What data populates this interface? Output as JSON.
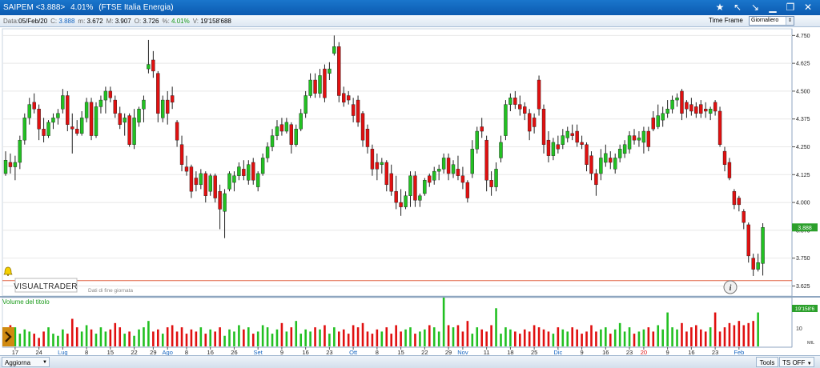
{
  "window": {
    "symbol": "SAIPEM <3.888>",
    "change": "4.01%",
    "index": "(FTSE Italia Energia)"
  },
  "info": {
    "data_label": "Data:",
    "date": "05/Feb/20",
    "close_label": "C:",
    "close": "3.888",
    "min_label": "m:",
    "min": "3.672",
    "max_label": "M:",
    "max": "3.907",
    "open_label": "O:",
    "open": "3.726",
    "pct_label": "%:",
    "pct": "4.01%",
    "vol_label": "V:",
    "volume": "19'158'688",
    "timeframe_label": "Time Frame",
    "timeframe_value": "Giornaliero"
  },
  "branding": {
    "logo": "VISUALTRADER",
    "note": "Dati di fine giornata"
  },
  "volume_panel": {
    "title": "Volume del titolo",
    "last_value": "19'158'6",
    "scale_label": "10",
    "unit_label": "MIL"
  },
  "status": {
    "update_label": "Aggiorna",
    "tools_label": "Tools",
    "ts_label": "TS OFF"
  },
  "colors": {
    "up": "#22c022",
    "down": "#e01010",
    "accent": "#1565c0",
    "alert_line": "#e06040",
    "price_box": "#2ca02c"
  },
  "icons": [
    "star-icon",
    "arrow-up-left-icon",
    "arrow-down-right-icon",
    "minimize-icon",
    "restore-icon",
    "close-icon",
    "bell-icon",
    "info-icon",
    "chevron-right-icon"
  ],
  "chart_data": {
    "type": "candlestick",
    "price_axis": {
      "ticks": [
        3.625,
        3.75,
        3.875,
        4.0,
        4.125,
        4.25,
        4.375,
        4.5,
        4.625,
        4.75
      ],
      "ylim": [
        3.58,
        4.78
      ]
    },
    "last_price_label": "3.888",
    "alert_level": 3.649,
    "x_labels": [
      {
        "i": 2,
        "t": "17"
      },
      {
        "i": 7,
        "t": "24"
      },
      {
        "i": 12,
        "t": "Lug",
        "month": true
      },
      {
        "i": 17,
        "t": "8"
      },
      {
        "i": 22,
        "t": "15"
      },
      {
        "i": 27,
        "t": "22"
      },
      {
        "i": 31,
        "t": "29"
      },
      {
        "i": 34,
        "t": "Ago",
        "month": true
      },
      {
        "i": 38,
        "t": "8"
      },
      {
        "i": 43,
        "t": "16"
      },
      {
        "i": 48,
        "t": "26"
      },
      {
        "i": 53,
        "t": "Set",
        "month": true
      },
      {
        "i": 58,
        "t": "9"
      },
      {
        "i": 63,
        "t": "16"
      },
      {
        "i": 68,
        "t": "23"
      },
      {
        "i": 73,
        "t": "Ott",
        "month": true
      },
      {
        "i": 78,
        "t": "8"
      },
      {
        "i": 83,
        "t": "15"
      },
      {
        "i": 88,
        "t": "22"
      },
      {
        "i": 93,
        "t": "29"
      },
      {
        "i": 96,
        "t": "Nov",
        "month": true
      },
      {
        "i": 101,
        "t": "11"
      },
      {
        "i": 106,
        "t": "18"
      },
      {
        "i": 111,
        "t": "25"
      },
      {
        "i": 116,
        "t": "Dic",
        "month": true
      },
      {
        "i": 121,
        "t": "9"
      },
      {
        "i": 126,
        "t": "16"
      },
      {
        "i": 131,
        "t": "23"
      },
      {
        "i": 134,
        "t": "20",
        "year": true
      },
      {
        "i": 139,
        "t": "9"
      },
      {
        "i": 144,
        "t": "16"
      },
      {
        "i": 149,
        "t": "23"
      },
      {
        "i": 154,
        "t": "Feb",
        "month": true
      }
    ],
    "candles": [
      {
        "o": 4.13,
        "h": 4.23,
        "l": 4.12,
        "c": 4.19
      },
      {
        "o": 4.18,
        "h": 4.22,
        "l": 4.13,
        "c": 4.16
      },
      {
        "o": 4.16,
        "h": 4.21,
        "l": 4.1,
        "c": 4.18
      },
      {
        "o": 4.18,
        "h": 4.3,
        "l": 4.15,
        "c": 4.28
      },
      {
        "o": 4.28,
        "h": 4.4,
        "l": 4.26,
        "c": 4.38
      },
      {
        "o": 4.38,
        "h": 4.47,
        "l": 4.35,
        "c": 4.44
      },
      {
        "o": 4.45,
        "h": 4.49,
        "l": 4.4,
        "c": 4.42
      },
      {
        "o": 4.42,
        "h": 4.44,
        "l": 4.28,
        "c": 4.33
      },
      {
        "o": 4.33,
        "h": 4.38,
        "l": 4.27,
        "c": 4.3
      },
      {
        "o": 4.3,
        "h": 4.37,
        "l": 4.29,
        "c": 4.36
      },
      {
        "o": 4.36,
        "h": 4.4,
        "l": 4.33,
        "c": 4.38
      },
      {
        "o": 4.38,
        "h": 4.42,
        "l": 4.35,
        "c": 4.4
      },
      {
        "o": 4.42,
        "h": 4.51,
        "l": 4.4,
        "c": 4.48
      },
      {
        "o": 4.48,
        "h": 4.5,
        "l": 4.32,
        "c": 4.35
      },
      {
        "o": 4.34,
        "h": 4.4,
        "l": 4.22,
        "c": 4.33
      },
      {
        "o": 4.33,
        "h": 4.37,
        "l": 4.3,
        "c": 4.31
      },
      {
        "o": 4.31,
        "h": 4.41,
        "l": 4.3,
        "c": 4.38
      },
      {
        "o": 4.38,
        "h": 4.47,
        "l": 4.36,
        "c": 4.45
      },
      {
        "o": 4.45,
        "h": 4.47,
        "l": 4.28,
        "c": 4.3
      },
      {
        "o": 4.3,
        "h": 4.45,
        "l": 4.29,
        "c": 4.43
      },
      {
        "o": 4.43,
        "h": 4.48,
        "l": 4.4,
        "c": 4.46
      },
      {
        "o": 4.46,
        "h": 4.52,
        "l": 4.4,
        "c": 4.5
      },
      {
        "o": 4.5,
        "h": 4.52,
        "l": 4.45,
        "c": 4.47
      },
      {
        "o": 4.46,
        "h": 4.48,
        "l": 4.38,
        "c": 4.4
      },
      {
        "o": 4.4,
        "h": 4.43,
        "l": 4.33,
        "c": 4.35
      },
      {
        "o": 4.36,
        "h": 4.4,
        "l": 4.3,
        "c": 4.38
      },
      {
        "o": 4.39,
        "h": 4.4,
        "l": 4.25,
        "c": 4.26
      },
      {
        "o": 4.26,
        "h": 4.42,
        "l": 4.24,
        "c": 4.38
      },
      {
        "o": 4.36,
        "h": 4.43,
        "l": 4.34,
        "c": 4.42
      },
      {
        "o": 4.42,
        "h": 4.48,
        "l": 4.36,
        "c": 4.46
      },
      {
        "o": 4.6,
        "h": 4.73,
        "l": 4.58,
        "c": 4.62
      },
      {
        "o": 4.64,
        "h": 4.68,
        "l": 4.56,
        "c": 4.59
      },
      {
        "o": 4.58,
        "h": 4.59,
        "l": 4.36,
        "c": 4.4
      },
      {
        "o": 4.38,
        "h": 4.48,
        "l": 4.36,
        "c": 4.46
      },
      {
        "o": 4.46,
        "h": 4.5,
        "l": 4.35,
        "c": 4.4
      },
      {
        "o": 4.48,
        "h": 4.52,
        "l": 4.42,
        "c": 4.45
      },
      {
        "o": 4.36,
        "h": 4.37,
        "l": 4.25,
        "c": 4.28
      },
      {
        "o": 4.26,
        "h": 4.3,
        "l": 4.14,
        "c": 4.17
      },
      {
        "o": 4.16,
        "h": 4.21,
        "l": 4.12,
        "c": 4.14
      },
      {
        "o": 4.16,
        "h": 4.17,
        "l": 4.02,
        "c": 4.05
      },
      {
        "o": 4.11,
        "h": 4.14,
        "l": 4.05,
        "c": 4.08
      },
      {
        "o": 4.08,
        "h": 4.15,
        "l": 4.06,
        "c": 4.13
      },
      {
        "o": 4.13,
        "h": 4.14,
        "l": 4.0,
        "c": 4.03
      },
      {
        "o": 4.05,
        "h": 4.13,
        "l": 4.03,
        "c": 4.12
      },
      {
        "o": 4.12,
        "h": 4.13,
        "l": 4.0,
        "c": 4.02
      },
      {
        "o": 4.05,
        "h": 4.08,
        "l": 3.88,
        "c": 3.97
      },
      {
        "o": 3.96,
        "h": 4.06,
        "l": 3.84,
        "c": 4.04
      },
      {
        "o": 4.06,
        "h": 4.14,
        "l": 4.05,
        "c": 4.13
      },
      {
        "o": 4.09,
        "h": 4.14,
        "l": 4.05,
        "c": 4.12
      },
      {
        "o": 4.12,
        "h": 4.18,
        "l": 4.1,
        "c": 4.16
      },
      {
        "o": 4.15,
        "h": 4.19,
        "l": 4.1,
        "c": 4.12
      },
      {
        "o": 4.1,
        "h": 4.19,
        "l": 4.08,
        "c": 4.17
      },
      {
        "o": 4.18,
        "h": 4.2,
        "l": 4.08,
        "c": 4.1
      },
      {
        "o": 4.07,
        "h": 4.14,
        "l": 4.05,
        "c": 4.13
      },
      {
        "o": 4.13,
        "h": 4.22,
        "l": 4.12,
        "c": 4.2
      },
      {
        "o": 4.2,
        "h": 4.27,
        "l": 4.18,
        "c": 4.25
      },
      {
        "o": 4.25,
        "h": 4.33,
        "l": 4.23,
        "c": 4.3
      },
      {
        "o": 4.3,
        "h": 4.37,
        "l": 4.28,
        "c": 4.34
      },
      {
        "o": 4.35,
        "h": 4.38,
        "l": 4.3,
        "c": 4.32
      },
      {
        "o": 4.32,
        "h": 4.38,
        "l": 4.31,
        "c": 4.36
      },
      {
        "o": 4.35,
        "h": 4.36,
        "l": 4.22,
        "c": 4.26
      },
      {
        "o": 4.26,
        "h": 4.35,
        "l": 4.25,
        "c": 4.33
      },
      {
        "o": 4.33,
        "h": 4.42,
        "l": 4.32,
        "c": 4.4
      },
      {
        "o": 4.4,
        "h": 4.5,
        "l": 4.38,
        "c": 4.48
      },
      {
        "o": 4.48,
        "h": 4.58,
        "l": 4.47,
        "c": 4.55
      },
      {
        "o": 4.55,
        "h": 4.58,
        "l": 4.47,
        "c": 4.49
      },
      {
        "o": 4.49,
        "h": 4.6,
        "l": 4.47,
        "c": 4.57
      },
      {
        "o": 4.6,
        "h": 4.62,
        "l": 4.45,
        "c": 4.47
      },
      {
        "o": 4.58,
        "h": 4.63,
        "l": 4.55,
        "c": 4.6
      },
      {
        "o": 4.67,
        "h": 4.75,
        "l": 4.66,
        "c": 4.7
      },
      {
        "o": 4.7,
        "h": 4.72,
        "l": 4.45,
        "c": 4.48
      },
      {
        "o": 4.49,
        "h": 4.52,
        "l": 4.43,
        "c": 4.45
      },
      {
        "o": 4.48,
        "h": 4.5,
        "l": 4.44,
        "c": 4.46
      },
      {
        "o": 4.44,
        "h": 4.47,
        "l": 4.36,
        "c": 4.39
      },
      {
        "o": 4.46,
        "h": 4.48,
        "l": 4.34,
        "c": 4.36
      },
      {
        "o": 4.4,
        "h": 4.41,
        "l": 4.25,
        "c": 4.28
      },
      {
        "o": 4.33,
        "h": 4.35,
        "l": 4.22,
        "c": 4.25
      },
      {
        "o": 4.24,
        "h": 4.26,
        "l": 4.12,
        "c": 4.15
      },
      {
        "o": 4.18,
        "h": 4.22,
        "l": 4.1,
        "c": 4.15
      },
      {
        "o": 4.17,
        "h": 4.2,
        "l": 4.13,
        "c": 4.18
      },
      {
        "o": 4.18,
        "h": 4.19,
        "l": 4.05,
        "c": 4.08
      },
      {
        "o": 4.13,
        "h": 4.17,
        "l": 4.03,
        "c": 4.05
      },
      {
        "o": 4.05,
        "h": 4.12,
        "l": 3.97,
        "c": 4.0
      },
      {
        "o": 4.0,
        "h": 4.06,
        "l": 3.94,
        "c": 3.98
      },
      {
        "o": 3.98,
        "h": 4.05,
        "l": 3.97,
        "c": 4.03
      },
      {
        "o": 4.03,
        "h": 4.14,
        "l": 3.98,
        "c": 4.12
      },
      {
        "o": 4.12,
        "h": 4.14,
        "l": 3.98,
        "c": 4.01
      },
      {
        "o": 4.01,
        "h": 4.04,
        "l": 3.98,
        "c": 4.03
      },
      {
        "o": 4.04,
        "h": 4.11,
        "l": 4.03,
        "c": 4.1
      },
      {
        "o": 4.12,
        "h": 4.13,
        "l": 4.07,
        "c": 4.09
      },
      {
        "o": 4.1,
        "h": 4.16,
        "l": 4.08,
        "c": 4.14
      },
      {
        "o": 4.14,
        "h": 4.17,
        "l": 4.1,
        "c": 4.15
      },
      {
        "o": 4.15,
        "h": 4.22,
        "l": 4.13,
        "c": 4.2
      },
      {
        "o": 4.2,
        "h": 4.22,
        "l": 4.1,
        "c": 4.13
      },
      {
        "o": 4.13,
        "h": 4.19,
        "l": 4.11,
        "c": 4.17
      },
      {
        "o": 4.15,
        "h": 4.21,
        "l": 4.1,
        "c": 4.12
      },
      {
        "o": 4.12,
        "h": 4.16,
        "l": 4.06,
        "c": 4.09
      },
      {
        "o": 4.09,
        "h": 4.1,
        "l": 4.0,
        "c": 4.02
      },
      {
        "o": 4.13,
        "h": 4.28,
        "l": 4.11,
        "c": 4.24
      },
      {
        "o": 4.24,
        "h": 4.34,
        "l": 4.22,
        "c": 4.32
      },
      {
        "o": 4.34,
        "h": 4.38,
        "l": 4.29,
        "c": 4.32
      },
      {
        "o": 4.28,
        "h": 4.3,
        "l": 4.05,
        "c": 4.1
      },
      {
        "o": 4.1,
        "h": 4.14,
        "l": 4.03,
        "c": 4.07
      },
      {
        "o": 4.07,
        "h": 4.18,
        "l": 4.05,
        "c": 4.15
      },
      {
        "o": 4.2,
        "h": 4.3,
        "l": 4.18,
        "c": 4.27
      },
      {
        "o": 4.3,
        "h": 4.46,
        "l": 4.28,
        "c": 4.44
      },
      {
        "o": 4.44,
        "h": 4.49,
        "l": 4.41,
        "c": 4.47
      },
      {
        "o": 4.47,
        "h": 4.5,
        "l": 4.42,
        "c": 4.44
      },
      {
        "o": 4.44,
        "h": 4.48,
        "l": 4.39,
        "c": 4.42
      },
      {
        "o": 4.43,
        "h": 4.45,
        "l": 4.37,
        "c": 4.4
      },
      {
        "o": 4.4,
        "h": 4.42,
        "l": 4.28,
        "c": 4.32
      },
      {
        "o": 4.38,
        "h": 4.4,
        "l": 4.31,
        "c": 4.34
      },
      {
        "o": 4.55,
        "h": 4.57,
        "l": 4.39,
        "c": 4.42
      },
      {
        "o": 4.42,
        "h": 4.44,
        "l": 4.22,
        "c": 4.26
      },
      {
        "o": 4.28,
        "h": 4.32,
        "l": 4.18,
        "c": 4.21
      },
      {
        "o": 4.21,
        "h": 4.29,
        "l": 4.19,
        "c": 4.27
      },
      {
        "o": 4.26,
        "h": 4.3,
        "l": 4.22,
        "c": 4.24
      },
      {
        "o": 4.26,
        "h": 4.33,
        "l": 4.24,
        "c": 4.3
      },
      {
        "o": 4.29,
        "h": 4.34,
        "l": 4.27,
        "c": 4.32
      },
      {
        "o": 4.31,
        "h": 4.35,
        "l": 4.28,
        "c": 4.3
      },
      {
        "o": 4.32,
        "h": 4.35,
        "l": 4.25,
        "c": 4.27
      },
      {
        "o": 4.27,
        "h": 4.3,
        "l": 4.24,
        "c": 4.26
      },
      {
        "o": 4.26,
        "h": 4.27,
        "l": 4.14,
        "c": 4.17
      },
      {
        "o": 4.21,
        "h": 4.23,
        "l": 4.1,
        "c": 4.13
      },
      {
        "o": 4.13,
        "h": 4.15,
        "l": 4.03,
        "c": 4.08
      },
      {
        "o": 4.13,
        "h": 4.24,
        "l": 4.1,
        "c": 4.2
      },
      {
        "o": 4.18,
        "h": 4.26,
        "l": 4.16,
        "c": 4.22
      },
      {
        "o": 4.2,
        "h": 4.23,
        "l": 4.15,
        "c": 4.18
      },
      {
        "o": 4.15,
        "h": 4.22,
        "l": 4.13,
        "c": 4.2
      },
      {
        "o": 4.2,
        "h": 4.26,
        "l": 4.18,
        "c": 4.24
      },
      {
        "o": 4.22,
        "h": 4.28,
        "l": 4.2,
        "c": 4.26
      },
      {
        "o": 4.24,
        "h": 4.32,
        "l": 4.22,
        "c": 4.3
      },
      {
        "o": 4.3,
        "h": 4.33,
        "l": 4.26,
        "c": 4.28
      },
      {
        "o": 4.28,
        "h": 4.32,
        "l": 4.25,
        "c": 4.29
      },
      {
        "o": 4.27,
        "h": 4.34,
        "l": 4.22,
        "c": 4.32
      },
      {
        "o": 4.32,
        "h": 4.34,
        "l": 4.23,
        "c": 4.25
      },
      {
        "o": 4.38,
        "h": 4.41,
        "l": 4.32,
        "c": 4.33
      },
      {
        "o": 4.34,
        "h": 4.44,
        "l": 4.33,
        "c": 4.39
      },
      {
        "o": 4.37,
        "h": 4.43,
        "l": 4.34,
        "c": 4.4
      },
      {
        "o": 4.4,
        "h": 4.46,
        "l": 4.38,
        "c": 4.42
      },
      {
        "o": 4.42,
        "h": 4.48,
        "l": 4.4,
        "c": 4.46
      },
      {
        "o": 4.46,
        "h": 4.49,
        "l": 4.43,
        "c": 4.47
      },
      {
        "o": 4.5,
        "h": 4.51,
        "l": 4.37,
        "c": 4.4
      },
      {
        "o": 4.45,
        "h": 4.46,
        "l": 4.38,
        "c": 4.42
      },
      {
        "o": 4.44,
        "h": 4.47,
        "l": 4.39,
        "c": 4.41
      },
      {
        "o": 4.43,
        "h": 4.45,
        "l": 4.38,
        "c": 4.4
      },
      {
        "o": 4.44,
        "h": 4.46,
        "l": 4.38,
        "c": 4.4
      },
      {
        "o": 4.42,
        "h": 4.45,
        "l": 4.38,
        "c": 4.41
      },
      {
        "o": 4.4,
        "h": 4.43,
        "l": 4.37,
        "c": 4.42
      },
      {
        "o": 4.45,
        "h": 4.46,
        "l": 4.39,
        "c": 4.41
      },
      {
        "o": 4.41,
        "h": 4.43,
        "l": 4.25,
        "c": 4.26
      },
      {
        "o": 4.23,
        "h": 4.25,
        "l": 4.14,
        "c": 4.17
      },
      {
        "o": 4.18,
        "h": 4.2,
        "l": 4.1,
        "c": 4.11
      },
      {
        "o": 4.05,
        "h": 4.06,
        "l": 3.97,
        "c": 3.99
      },
      {
        "o": 4.02,
        "h": 4.03,
        "l": 3.96,
        "c": 3.99
      },
      {
        "o": 3.96,
        "h": 3.97,
        "l": 3.88,
        "c": 3.91
      },
      {
        "o": 3.9,
        "h": 3.91,
        "l": 3.73,
        "c": 3.76
      },
      {
        "o": 3.75,
        "h": 3.77,
        "l": 3.67,
        "c": 3.7
      },
      {
        "o": 3.7,
        "h": 3.77,
        "l": 3.69,
        "c": 3.73
      },
      {
        "o": 3.726,
        "h": 3.907,
        "l": 3.672,
        "c": 3.888
      }
    ],
    "volume": [
      6,
      10,
      9,
      6,
      8,
      7,
      6,
      4,
      7,
      9,
      6,
      5,
      8,
      6,
      13,
      9,
      7,
      10,
      8,
      6,
      9,
      7,
      8,
      11,
      9,
      6,
      7,
      5,
      8,
      9,
      12,
      7,
      8,
      6,
      9,
      10,
      7,
      9,
      6,
      8,
      7,
      9,
      6,
      8,
      7,
      9,
      5,
      8,
      7,
      10,
      8,
      9,
      6,
      7,
      10,
      9,
      6,
      8,
      11,
      7,
      9,
      12,
      6,
      8,
      7,
      9,
      8,
      10,
      6,
      9,
      7,
      8,
      6,
      10,
      9,
      11,
      7,
      6,
      8,
      7,
      9,
      6,
      10,
      7,
      8,
      9,
      6,
      7,
      8,
      10,
      9,
      7,
      23,
      10,
      9,
      10,
      7,
      12,
      6,
      9,
      8,
      7,
      10,
      18,
      6,
      9,
      8,
      7,
      6,
      8,
      7,
      10,
      9,
      8,
      7,
      6,
      9,
      8,
      7,
      9,
      8,
      6,
      7,
      10,
      7,
      8,
      9,
      6,
      8,
      11,
      7,
      9,
      6,
      7,
      8,
      9,
      7,
      10,
      8,
      16,
      9,
      8,
      11,
      7,
      9,
      10,
      8,
      7,
      9,
      16,
      7,
      9,
      11,
      10,
      12,
      10,
      11,
      12,
      16
    ]
  }
}
